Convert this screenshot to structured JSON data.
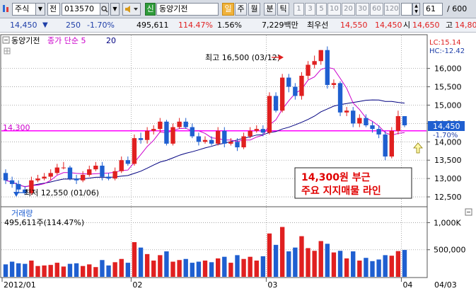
{
  "toolbar": {
    "market_type": "주식",
    "prefix": "전",
    "stock_code": "013570",
    "stock_name": "동양기전",
    "badge": "신",
    "period_buttons": [
      "일",
      "주",
      "월",
      "분",
      "틱"
    ],
    "minute_buttons": [
      "1",
      "3",
      "5",
      "10",
      "20",
      "30",
      "60",
      "120"
    ],
    "count_value": "61",
    "total_count": "/ 600"
  },
  "quote": {
    "price": "14,450",
    "change": "250",
    "change_pct": "-1.70%",
    "volume": "495,611",
    "volume_ratio": "114.47%",
    "turnover": "1.56%",
    "amount": "7,229백만",
    "best_label": "최우선",
    "best_ask": "14,550",
    "best_bid": "14,450",
    "open_label": "시",
    "open": "14,650",
    "high_label": "고",
    "high": "14,80"
  },
  "price_panel": {
    "stock_label": "동양기전",
    "indicator_label": "종가 단순 5",
    "indicator_value": "20",
    "lc_label": "LC:15.14",
    "hc_label": "HC:-12.42",
    "current_price_tag": "14,450",
    "current_change_tag": "-1.70%",
    "hline_label": "14,300",
    "high_annotation": "최고 16,500 (03/12)",
    "low_annotation": "최저 12,550 (01/06)",
    "callout_line1": "14,300원 부근",
    "callout_line2": "주요 지지매물 라인"
  },
  "volume_panel": {
    "title": "거래량",
    "info": "495,611주(114.47%)"
  },
  "colors": {
    "up": "#e02020",
    "down": "#1f5fd0",
    "support_line": "#ff00ff",
    "ma_short": "#cc00cc",
    "ma_long": "#000080",
    "callout_text": "#e00000"
  },
  "chart_data": [
    {
      "type": "candlestick",
      "title": "동양기전",
      "x": [
        "2012/01/02",
        "2012/01/03",
        "2012/01/04",
        "2012/01/05",
        "2012/01/06",
        "2012/01/09",
        "2012/01/10",
        "2012/01/11",
        "2012/01/12",
        "2012/01/13",
        "2012/01/16",
        "2012/01/17",
        "2012/01/18",
        "2012/01/19",
        "2012/01/20",
        "2012/01/25",
        "2012/01/26",
        "2012/01/27",
        "2012/01/30",
        "2012/01/31",
        "2012/02/01",
        "2012/02/02",
        "2012/02/03",
        "2012/02/06",
        "2012/02/07",
        "2012/02/08",
        "2012/02/09",
        "2012/02/10",
        "2012/02/13",
        "2012/02/14",
        "2012/02/15",
        "2012/02/16",
        "2012/02/17",
        "2012/02/20",
        "2012/02/21",
        "2012/02/22",
        "2012/02/23",
        "2012/02/24",
        "2012/02/27",
        "2012/02/28",
        "2012/02/29",
        "2012/03/02",
        "2012/03/05",
        "2012/03/06",
        "2012/03/07",
        "2012/03/08",
        "2012/03/09",
        "2012/03/12",
        "2012/03/13",
        "2012/03/14",
        "2012/03/15",
        "2012/03/16",
        "2012/03/19",
        "2012/03/20",
        "2012/03/21",
        "2012/03/22",
        "2012/03/23",
        "2012/03/26",
        "2012/03/27",
        "2012/03/28",
        "2012/03/29",
        "2012/03/30",
        "2012/04/02"
      ],
      "open": [
        13150,
        12950,
        12850,
        12700,
        12600,
        12950,
        13000,
        13050,
        13150,
        13300,
        13300,
        13000,
        12950,
        13100,
        13250,
        13350,
        13050,
        13000,
        13200,
        13500,
        13400,
        14100,
        14050,
        14300,
        14350,
        14550,
        13950,
        14400,
        14550,
        14400,
        14150,
        14000,
        14050,
        13950,
        14300,
        13950,
        14000,
        13850,
        14150,
        14300,
        14350,
        14250,
        15250,
        14850,
        15750,
        15500,
        15250,
        15800,
        16100,
        16200,
        16500,
        15550,
        15600,
        14800,
        14850,
        14500,
        14650,
        14450,
        14350,
        14200,
        13600,
        14300,
        14700
      ],
      "close": [
        12950,
        12850,
        12700,
        12600,
        12950,
        13000,
        13050,
        13150,
        13300,
        13300,
        13000,
        12950,
        13100,
        13250,
        13350,
        13050,
        13000,
        13200,
        13500,
        13400,
        14100,
        14050,
        14300,
        14350,
        14550,
        13950,
        14400,
        14550,
        14400,
        14150,
        14000,
        14050,
        13950,
        14300,
        13950,
        14000,
        13850,
        14150,
        14300,
        14350,
        14250,
        15250,
        14850,
        15750,
        15500,
        15250,
        15800,
        16100,
        16200,
        16500,
        15550,
        15600,
        14800,
        14850,
        14500,
        14650,
        14450,
        14350,
        14200,
        13600,
        14300,
        14700,
        14450
      ],
      "high": [
        13250,
        13050,
        12950,
        12800,
        13050,
        13100,
        13150,
        13250,
        13400,
        13450,
        13350,
        13100,
        13200,
        13350,
        13450,
        13450,
        13150,
        13300,
        13600,
        13600,
        14200,
        14250,
        14400,
        14450,
        14650,
        14600,
        14500,
        14650,
        14650,
        14500,
        14250,
        14150,
        14150,
        14400,
        14400,
        14100,
        14100,
        14250,
        14400,
        14450,
        14450,
        15350,
        15350,
        15850,
        15850,
        15600,
        15900,
        16200,
        16350,
        16500,
        16600,
        15700,
        15650,
        14950,
        14950,
        14750,
        14750,
        14550,
        14450,
        14300,
        14400,
        14850,
        14700
      ],
      "low": [
        12850,
        12750,
        12600,
        12550,
        12550,
        12900,
        12950,
        12950,
        13100,
        13250,
        12950,
        12850,
        12900,
        13050,
        13200,
        12950,
        12950,
        12950,
        13150,
        13350,
        13350,
        13950,
        13950,
        14200,
        14250,
        13900,
        13900,
        14350,
        14350,
        14100,
        13900,
        13950,
        13900,
        13900,
        13850,
        13900,
        13750,
        13800,
        14100,
        14250,
        14150,
        14200,
        14800,
        14800,
        15350,
        15150,
        15150,
        15700,
        16000,
        16100,
        15450,
        15450,
        14700,
        14700,
        14400,
        14400,
        14400,
        14250,
        14100,
        13500,
        13550,
        14200,
        14400
      ],
      "ma_short_label": "종가 단순 5",
      "ma_long_label": "20",
      "support_line": 14300,
      "annotations": [
        {
          "text": "최고 16,500 (03/12)",
          "value": 16500
        },
        {
          "text": "최저 12,550 (01/06)",
          "value": 12550
        }
      ],
      "yticks": [
        12500,
        13000,
        13500,
        14000,
        14500,
        15000,
        15500,
        16000
      ],
      "ylim": [
        12250,
        16900
      ],
      "xtick_labels": [
        "2012/01",
        "02",
        "03",
        "04",
        "04/03"
      ]
    },
    {
      "type": "bar",
      "title": "거래량",
      "values": [
        230000,
        280000,
        250000,
        240000,
        300000,
        200000,
        210000,
        220000,
        260000,
        190000,
        240000,
        250000,
        200000,
        230000,
        180000,
        310000,
        210000,
        270000,
        330000,
        260000,
        640000,
        540000,
        420000,
        300000,
        400000,
        470000,
        280000,
        310000,
        330000,
        260000,
        280000,
        300000,
        270000,
        340000,
        370000,
        260000,
        400000,
        330000,
        370000,
        300000,
        380000,
        800000,
        590000,
        920000,
        470000,
        540000,
        750000,
        530000,
        480000,
        660000,
        610000,
        450000,
        480000,
        340000,
        470000,
        300000,
        350000,
        290000,
        320000,
        400000,
        390000,
        475000,
        495611
      ],
      "yticks": [
        500000,
        1000000
      ],
      "ytick_labels": [
        "500,000",
        "1,000K"
      ],
      "ylim": [
        0,
        1280000
      ]
    }
  ]
}
